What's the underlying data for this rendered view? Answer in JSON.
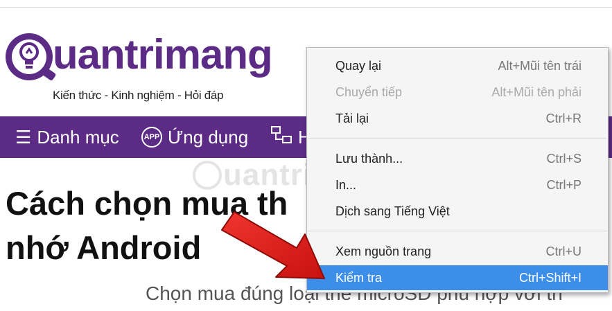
{
  "logo": {
    "wordmark": "uantrimang",
    "tagline": "Kiến thức - Kinh nghiệm - Hỏi đáp",
    "brand_color": "#5b2b86"
  },
  "nav": {
    "items": [
      {
        "icon": "hamburger-icon",
        "label": "Danh mục"
      },
      {
        "icon": "app-icon",
        "label": "Ứng dụng"
      },
      {
        "icon": "network-icon",
        "label": "H"
      }
    ]
  },
  "article": {
    "headline_line1": "Cách chọn mua th",
    "headline_line2": "nhớ Android",
    "subtitle": "Chọn mua đúng loại thẻ microSD phù hợp với th"
  },
  "watermark": {
    "text": "uantrimang"
  },
  "context_menu": {
    "groups": [
      [
        {
          "label": "Quay lại",
          "shortcut": "Alt+Mũi tên trái",
          "disabled": false
        },
        {
          "label": "Chuyển tiếp",
          "shortcut": "Alt+Mũi tên phải",
          "disabled": true
        },
        {
          "label": "Tải lại",
          "shortcut": "Ctrl+R",
          "disabled": false
        }
      ],
      [
        {
          "label": "Lưu thành...",
          "shortcut": "Ctrl+S",
          "disabled": false
        },
        {
          "label": "In...",
          "shortcut": "Ctrl+P",
          "disabled": false
        },
        {
          "label": "Dịch sang Tiếng Việt",
          "shortcut": "",
          "disabled": false
        }
      ],
      [
        {
          "label": "Xem nguồn trang",
          "shortcut": "Ctrl+U",
          "disabled": false
        },
        {
          "label": "Kiểm tra",
          "shortcut": "Ctrl+Shift+I",
          "disabled": false,
          "highlighted": true
        }
      ]
    ],
    "highlight_color": "#3d8ee8"
  },
  "annotation": {
    "arrow_color": "#e3201b"
  }
}
